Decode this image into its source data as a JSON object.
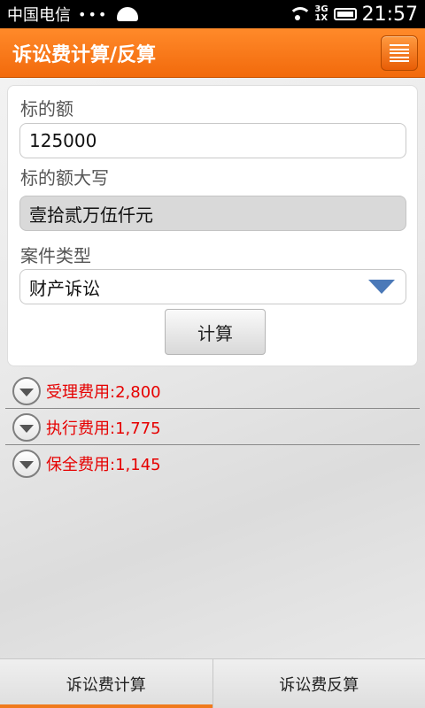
{
  "status_bar": {
    "carrier": "中国电信",
    "dots": "•••",
    "network_top": "3G",
    "network_bottom": "1X",
    "time": "21:57"
  },
  "title_bar": {
    "title": "诉讼费计算/反算"
  },
  "form": {
    "amount_label": "标的额",
    "amount_value": "125000",
    "amount_upper_label": "标的额大写",
    "amount_upper_value": "壹拾贰万伍仟元",
    "case_type_label": "案件类型",
    "case_type_value": "财产诉讼",
    "calculate_label": "计算"
  },
  "results": [
    {
      "text": "受理费用:2,800"
    },
    {
      "text": "执行费用:1,775"
    },
    {
      "text": "保全费用:1,145"
    }
  ],
  "tabs": [
    {
      "label": "诉讼费计算",
      "active": true
    },
    {
      "label": "诉讼费反算",
      "active": false
    }
  ],
  "colors": {
    "accent": "#f26a0c",
    "result_text": "#e60000",
    "dropdown_arrow": "#4b79b8"
  }
}
